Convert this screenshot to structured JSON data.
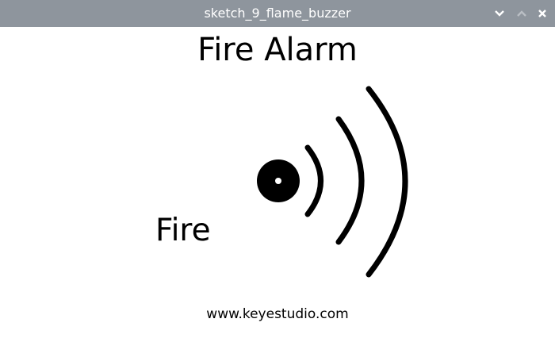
{
  "window": {
    "title": "sketch_9_flame_buzzer",
    "titlebar_color": "#8e959d",
    "controls": [
      {
        "name": "minimize",
        "icon": "chevron-down-icon"
      },
      {
        "name": "maximize",
        "icon": "chevron-up-icon"
      },
      {
        "name": "close",
        "icon": "close-icon"
      }
    ]
  },
  "sketch": {
    "heading": "Fire Alarm",
    "status": "Fire",
    "footer": "www.keyestudio.com",
    "graphic_icon": "buzzer-sound-waves-icon",
    "graphic_color": "#000000"
  }
}
